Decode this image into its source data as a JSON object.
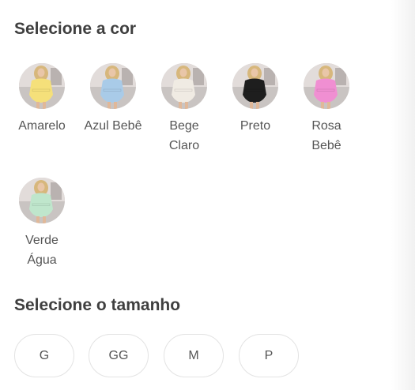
{
  "color_section": {
    "title": "Selecione a cor",
    "swatches": [
      {
        "label": "Amarelo",
        "color": "#f5e07a"
      },
      {
        "label": "Azul Bebê",
        "color": "#a9cbe8"
      },
      {
        "label": "Bege Claro",
        "color": "#f0ebe3"
      },
      {
        "label": "Preto",
        "color": "#1e1e1e"
      },
      {
        "label": "Rosa Bebê",
        "color": "#f08fd2"
      },
      {
        "label": "Verde Água",
        "color": "#bfe6cc"
      }
    ]
  },
  "size_section": {
    "title": "Selecione o tamanho",
    "sizes": [
      "G",
      "GG",
      "M",
      "P"
    ]
  }
}
